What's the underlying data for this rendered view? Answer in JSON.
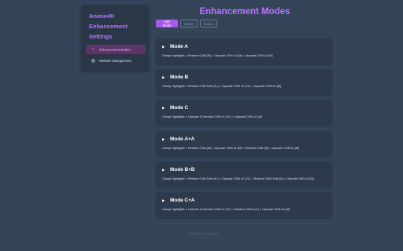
{
  "sidebar": {
    "title": "Anime4K Enhancement Settings",
    "items": [
      {
        "label": "Enhancement Modes",
        "icon": "sparkle-icon",
        "active": true
      },
      {
        "label": "Website Management",
        "icon": "globe-icon",
        "active": false
      }
    ]
  },
  "main": {
    "title": "Enhancement Modes",
    "actions": {
      "add": "Add Mode",
      "import": "Import",
      "export": "Export"
    },
    "modes": [
      {
        "name": "Mode A",
        "chain": "Clamp Highlights > Restore CNN (M) > Upscale CNN x2 (M) > Upscale CNN x2 (M)"
      },
      {
        "name": "Mode B",
        "chain": "Clamp Highlights > Restore CNN Soft (VL) > Upscale CNN x2 (VL) > Upscale CNN x2 (M)"
      },
      {
        "name": "Mode C",
        "chain": "Clamp Highlights > Upscale & Denoise CNN x2 (VL) > Upscale CNN x2 (M)"
      },
      {
        "name": "Mode A+A",
        "chain": "Clamp Highlights > Restore CNN (M) > Upscale CNN x2 (M) > Restore CNN (M) > Upscale CNN x2 (M)"
      },
      {
        "name": "Mode B+B",
        "chain": "Clamp Highlights > Restore CNN Soft (VL) > Upscale CNN x2 (VL) > Restore CNN Soft (M) > Upscale CNN x2 (M)"
      },
      {
        "name": "Mode C+A",
        "chain": "Clamp Highlights > Upscale & Denoise CNN x2 (VL) > Restore CNN (VL) > Upscale CNN x2 (M)"
      }
    ]
  },
  "footer": {
    "text": "Anime4K WebExtension"
  },
  "colors": {
    "background": "#34455a",
    "card": "#2c3a4c",
    "accent": "#b675ff",
    "primary_button": "#a857f0"
  }
}
